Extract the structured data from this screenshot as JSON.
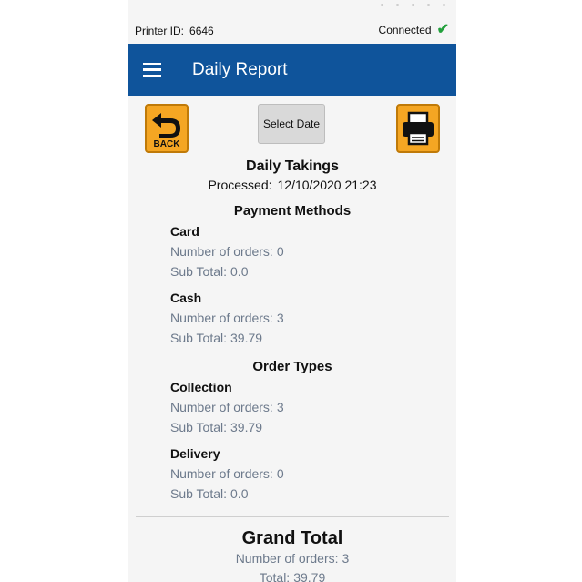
{
  "status": {
    "printer_label": "Printer ID:",
    "printer_id": "6646",
    "connection": "Connected",
    "connection_icon": "check-icon",
    "connection_color": "#22a03c"
  },
  "appbar": {
    "title": "Daily Report",
    "color": "#0f549b",
    "menu_icon": "hamburger-icon"
  },
  "toolbar": {
    "back_label": "BACK",
    "select_date_label": "Select Date",
    "print_icon": "printer-icon",
    "accent": "#f5a623"
  },
  "takings": {
    "title": "Daily Takings",
    "processed_label": "Processed:",
    "processed_value": "12/10/2020 21:23"
  },
  "payment_methods": {
    "title": "Payment Methods",
    "items": [
      {
        "name": "Card",
        "orders_label": "Number of orders:",
        "orders": "0",
        "subtotal_label": "Sub Total:",
        "subtotal": "0.0"
      },
      {
        "name": "Cash",
        "orders_label": "Number of orders:",
        "orders": "3",
        "subtotal_label": "Sub Total:",
        "subtotal": "39.79"
      }
    ]
  },
  "order_types": {
    "title": "Order Types",
    "items": [
      {
        "name": "Collection",
        "orders_label": "Number of orders:",
        "orders": "3",
        "subtotal_label": "Sub Total:",
        "subtotal": "39.79"
      },
      {
        "name": "Delivery",
        "orders_label": "Number of orders:",
        "orders": "0",
        "subtotal_label": "Sub Total:",
        "subtotal": "0.0"
      }
    ]
  },
  "grand_total": {
    "title": "Grand Total",
    "orders_label": "Number of orders:",
    "orders": "3",
    "total_label": "Total:",
    "total": "39.79"
  }
}
